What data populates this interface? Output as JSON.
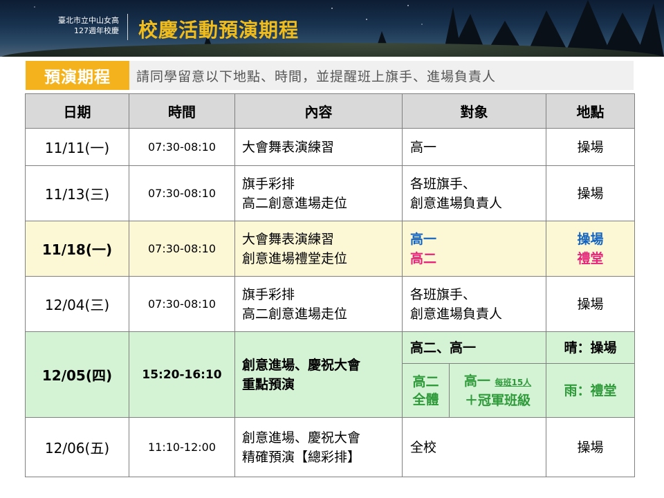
{
  "header": {
    "school_line1": "臺北市立中山女高",
    "school_line2": "127週年校慶",
    "title": "校慶活動預演期程"
  },
  "subtitle": {
    "tag": "預演期程",
    "note": "請同學留意以下地點、時間，並提醒班上旗手、進場負責人"
  },
  "table": {
    "headers": [
      "日期",
      "時間",
      "內容",
      "對象",
      "地點"
    ],
    "rows": [
      {
        "date": "11/11(一)",
        "time": "07:30-08:10",
        "content": [
          "大會舞表演練習"
        ],
        "target": [
          "高一"
        ],
        "location": [
          "操場"
        ]
      },
      {
        "date": "11/13(三)",
        "time": "07:30-08:10",
        "content": [
          "旗手彩排",
          "高二創意進場走位"
        ],
        "target": [
          "各班旗手、",
          "創意進場負責人"
        ],
        "location": [
          "操場"
        ]
      },
      {
        "date": "11/18(一)",
        "time": "07:30-08:10",
        "content": [
          "大會舞表演練習",
          "創意進場禮堂走位"
        ],
        "target": [
          "高一",
          "高二"
        ],
        "location": [
          "操場",
          "禮堂"
        ]
      },
      {
        "date": "12/04(三)",
        "time": "07:30-08:10",
        "content": [
          "旗手彩排",
          "高二創意進場走位"
        ],
        "target": [
          "各班旗手、",
          "創意進場負責人"
        ],
        "location": [
          "操場"
        ]
      },
      {
        "date": "12/05(四)",
        "time": "15:20-16:10",
        "content": [
          "創意進場、慶祝大會",
          "重點預演"
        ],
        "target_sunny": "高二、高一",
        "location_sunny": "晴：操場",
        "target_rain_a": [
          "高二",
          "全體"
        ],
        "target_rain_b_main": "高一",
        "target_rain_b_small": "每班15人",
        "target_rain_b_line2": "＋冠軍班級",
        "location_rain": "雨：禮堂"
      },
      {
        "date": "12/06(五)",
        "time": "11:10-12:00",
        "content": [
          "創意進場、慶祝大會",
          "精確預演【總彩排】"
        ],
        "target": [
          "全校"
        ],
        "location": [
          "操場"
        ]
      }
    ]
  },
  "colors": {
    "title_gold": "#f1bd1c",
    "tag_orange": "#f4b21d",
    "highlight_yellow": "#fcf8d6",
    "highlight_green": "#d4f2d4",
    "blue_text": "#1565c0",
    "pink_text": "#e5247a",
    "green_text": "#2e9a3a"
  }
}
